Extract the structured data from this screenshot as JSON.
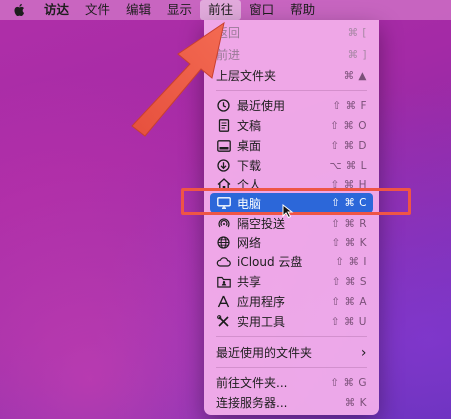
{
  "menubar": {
    "app": "访达",
    "items": [
      "文件",
      "编辑",
      "显示",
      "前往",
      "窗口",
      "帮助"
    ],
    "active": "前往"
  },
  "menu": {
    "nav": [
      {
        "label": "返回",
        "shortcut": "⌘ [",
        "disabled": true
      },
      {
        "label": "前进",
        "shortcut": "⌘ ]",
        "disabled": true
      },
      {
        "label": "上层文件夹",
        "shortcut": "⌘ ▲",
        "disabled": false
      }
    ],
    "places": [
      {
        "icon": "clock-icon",
        "label": "最近使用",
        "shortcut": "⇧ ⌘ F"
      },
      {
        "icon": "document-icon",
        "label": "文稿",
        "shortcut": "⇧ ⌘ O"
      },
      {
        "icon": "desktop-icon",
        "label": "桌面",
        "shortcut": "⇧ ⌘ D"
      },
      {
        "icon": "download-icon",
        "label": "下载",
        "shortcut": "⌥ ⌘ L"
      },
      {
        "icon": "home-icon",
        "label": "个人",
        "shortcut": "⇧ ⌘ H"
      },
      {
        "icon": "computer-icon",
        "label": "电脑",
        "shortcut": "⇧ ⌘ C",
        "selected": true
      },
      {
        "icon": "airdrop-icon",
        "label": "隔空投送",
        "shortcut": "⇧ ⌘ R"
      },
      {
        "icon": "globe-icon",
        "label": "网络",
        "shortcut": "⇧ ⌘ K"
      },
      {
        "icon": "cloud-icon",
        "label": "iCloud 云盘",
        "shortcut": "⇧ ⌘ I"
      },
      {
        "icon": "shared-folder-icon",
        "label": "共享",
        "shortcut": "⇧ ⌘ S"
      },
      {
        "icon": "applications-icon",
        "label": "应用程序",
        "shortcut": "⇧ ⌘ A"
      },
      {
        "icon": "utilities-icon",
        "label": "实用工具",
        "shortcut": "⇧ ⌘ U"
      }
    ],
    "recent_folders": {
      "label": "最近使用的文件夹",
      "submenu_glyph": "›"
    },
    "bottom": [
      {
        "label": "前往文件夹...",
        "shortcut": "⇧ ⌘ G"
      },
      {
        "label": "连接服务器...",
        "shortcut": "⌘ K"
      }
    ]
  },
  "annotation": {
    "color": "#ef5545"
  }
}
